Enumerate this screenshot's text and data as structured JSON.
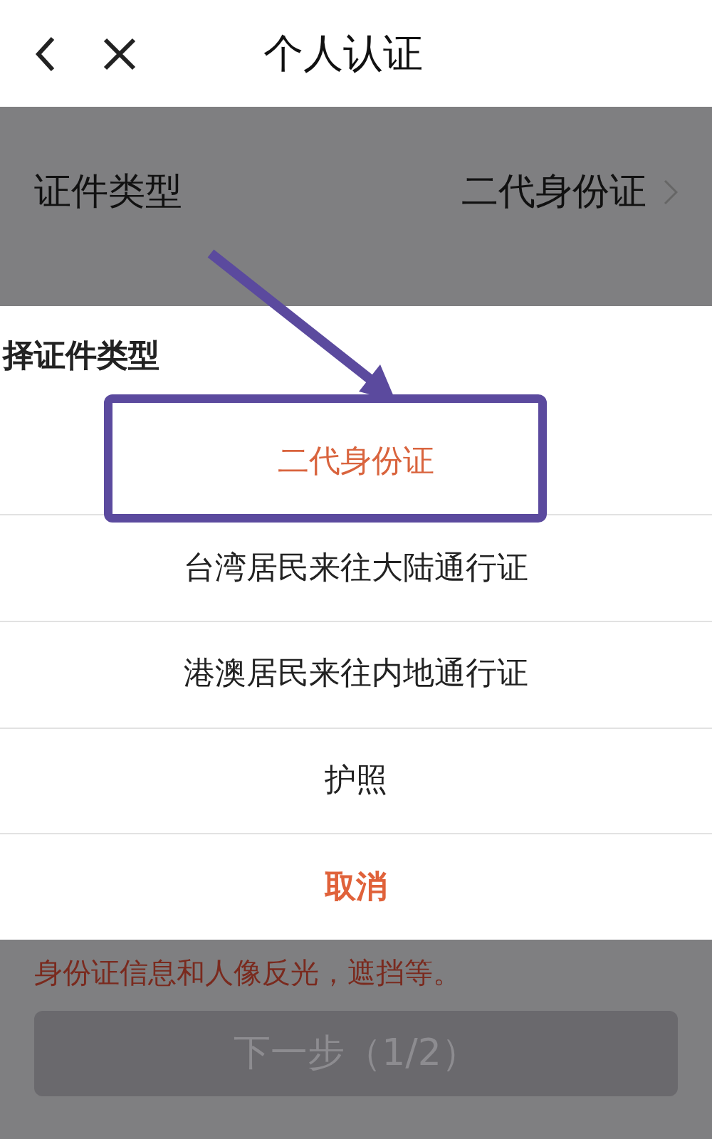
{
  "header": {
    "title": "个人认证"
  },
  "field_row": {
    "label": "证件类型",
    "value": "二代身份证"
  },
  "sheet": {
    "title": "择证件类型",
    "options": [
      {
        "label": "二代身份证",
        "kind": "option",
        "selected": true
      },
      {
        "label": "台湾居民来往大陆通行证",
        "kind": "option",
        "selected": false
      },
      {
        "label": "港澳居民来往内地通行证",
        "kind": "option",
        "selected": false
      },
      {
        "label": "护照",
        "kind": "option",
        "selected": false
      },
      {
        "label": "取消",
        "kind": "cancel"
      }
    ]
  },
  "notice": "身份证信息和人像反光，遮挡等。",
  "next_button": {
    "label": "下一步（1/2）",
    "disabled": true
  }
}
